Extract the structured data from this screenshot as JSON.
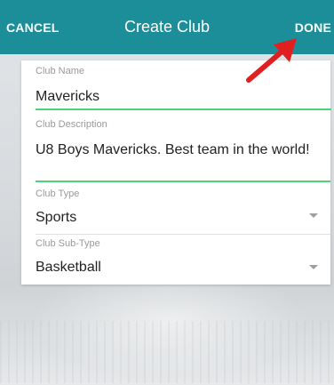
{
  "header": {
    "cancel_label": "CANCEL",
    "title": "Create Club",
    "done_label": "DONE",
    "background_color": "#1b8e9a"
  },
  "form": {
    "club_name": {
      "label": "Club Name",
      "value": "Mavericks"
    },
    "club_description": {
      "label": "Club Description",
      "value": "U8 Boys Mavericks. Best team in the world!"
    },
    "club_type": {
      "label": "Club Type",
      "value": "Sports"
    },
    "club_sub_type": {
      "label": "Club Sub-Type",
      "value": "Basketball"
    },
    "active_underline_color": "#4cd37c"
  },
  "annotation": {
    "icon": "red-arrow-icon",
    "color": "#e02020"
  }
}
